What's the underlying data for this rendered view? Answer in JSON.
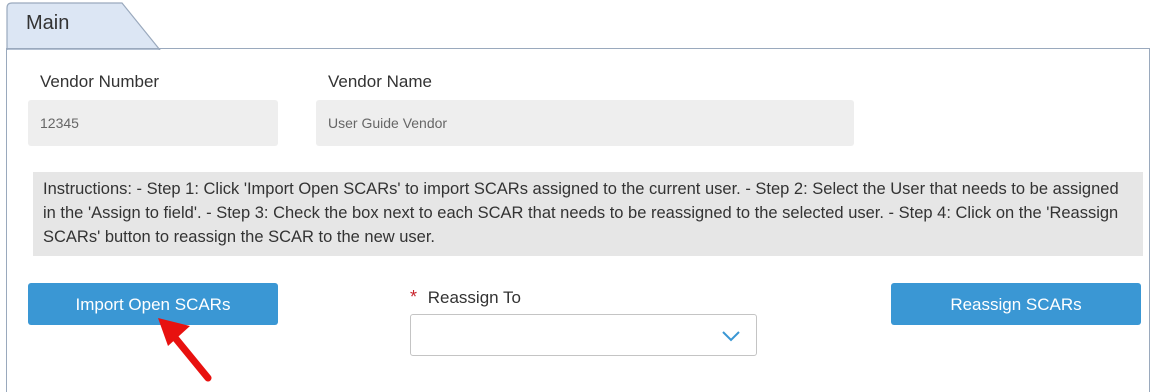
{
  "tabs": [
    {
      "label": "Main",
      "active": true
    }
  ],
  "vendor": {
    "number_label": "Vendor Number",
    "number_value": "12345",
    "name_label": "Vendor Name",
    "name_value": "User Guide Vendor"
  },
  "instructions": "Instructions: - Step 1: Click 'Import Open SCARs' to import SCARs assigned to the current user. - Step 2: Select the User that needs to be assigned in the 'Assign to field'. - Step 3: Check the box next to each SCAR that needs to be reassigned to the selected user. - Step 4: Click on the 'Reassign SCARs' button to reassign the SCAR to the new user.",
  "actions": {
    "import_label": "Import Open SCARs",
    "reassign_label": "Reassign SCARs"
  },
  "reassign_to": {
    "required_marker": "*",
    "label": "Reassign To",
    "value": ""
  },
  "icons": {
    "dropdown": "chevron-down-icon",
    "annotation": "red-arrow-icon"
  },
  "colors": {
    "button": "#3a97d4",
    "tab_fill": "#dce6f4",
    "required": "#c8232c",
    "annotation": "#e8110f"
  }
}
